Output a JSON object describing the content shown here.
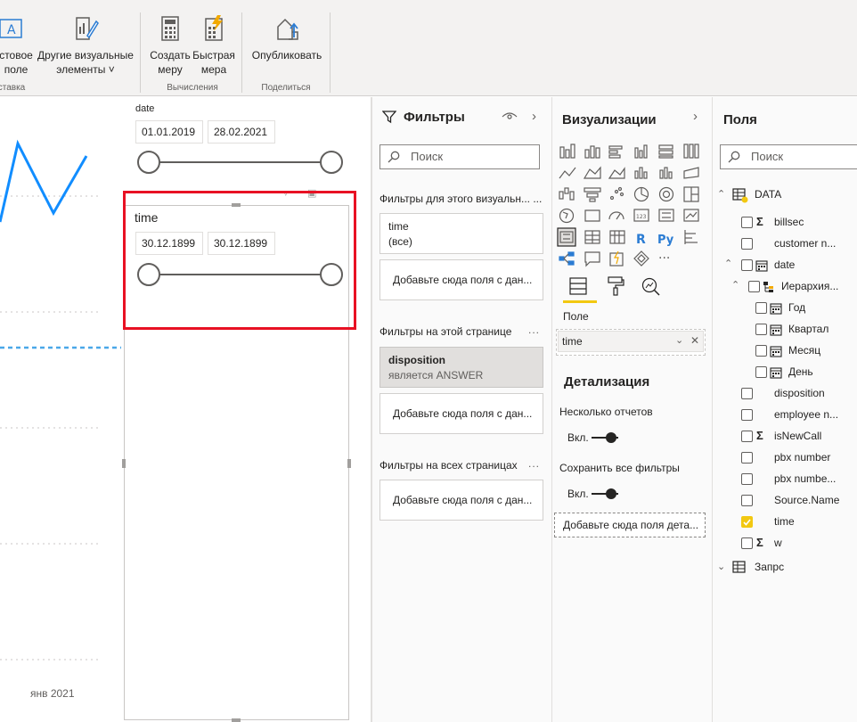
{
  "ribbon": {
    "buttons": [
      {
        "label1": "стовое",
        "label2": "поле"
      },
      {
        "label1": "Другие визуальные",
        "label2": "элементы ˅"
      },
      {
        "label1": "Создать",
        "label2": "меру"
      },
      {
        "label1": "Быстрая",
        "label2": "мера"
      },
      {
        "label1": "Опубликовать",
        "label2": ""
      }
    ],
    "groups": [
      "ставка",
      "Вычисления",
      "Поделиться"
    ]
  },
  "canvas": {
    "date_slicer": {
      "title": "date",
      "start": "01.01.2019",
      "end": "28.02.2021"
    },
    "time_slicer": {
      "title": "time",
      "start": "30.12.1899",
      "end": "30.12.1899"
    },
    "x_axis_label": "янв 2021"
  },
  "filters": {
    "title": "Фильтры",
    "search_placeholder": "Поиск",
    "visual_section": "Фильтры для этого визуальн... ...",
    "page_section": "Фильтры на этой странице",
    "all_section": "Фильтры на всех страницах",
    "time_card": {
      "name": "time",
      "value": "(все)"
    },
    "add_field": "Добавьте сюда поля с дан...",
    "disposition_card": {
      "name": "disposition",
      "value": "является ANSWER"
    },
    "more": "..."
  },
  "visualizations": {
    "title": "Визуализации",
    "field_label": "Поле",
    "field_value": "time",
    "drill_title": "Детализация",
    "multi_reports": "Несколько отчетов",
    "keep_filters": "Сохранить все фильтры",
    "toggle_on": "Вкл.",
    "drill_add": "Добавьте сюда поля дета...",
    "more_icon": "···"
  },
  "fields": {
    "title": "Поля",
    "search_placeholder": "Поиск",
    "table_name": "DATA",
    "items": [
      {
        "name": "billsec",
        "sigma": true
      },
      {
        "name": "customer n...",
        "sigma": false
      },
      {
        "name": "date",
        "sigma": false
      },
      {
        "name": "Иерархия...",
        "sigma": false
      },
      {
        "name": "Год",
        "sigma": false
      },
      {
        "name": "Квартал",
        "sigma": false
      },
      {
        "name": "Месяц",
        "sigma": false
      },
      {
        "name": "День",
        "sigma": false
      },
      {
        "name": "disposition",
        "sigma": false
      },
      {
        "name": "employee n...",
        "sigma": false
      },
      {
        "name": "isNewCall",
        "sigma": true
      },
      {
        "name": "pbx number",
        "sigma": false
      },
      {
        "name": "pbx numbe...",
        "sigma": false
      },
      {
        "name": "Source.Name",
        "sigma": false
      },
      {
        "name": "time",
        "sigma": false,
        "checked": true
      },
      {
        "name": "w",
        "sigma": true
      }
    ],
    "table2_name": "Запрс"
  },
  "colors": {
    "accent": "#f2c811",
    "selection_red": "#e81123",
    "line_blue": "#118dff"
  }
}
